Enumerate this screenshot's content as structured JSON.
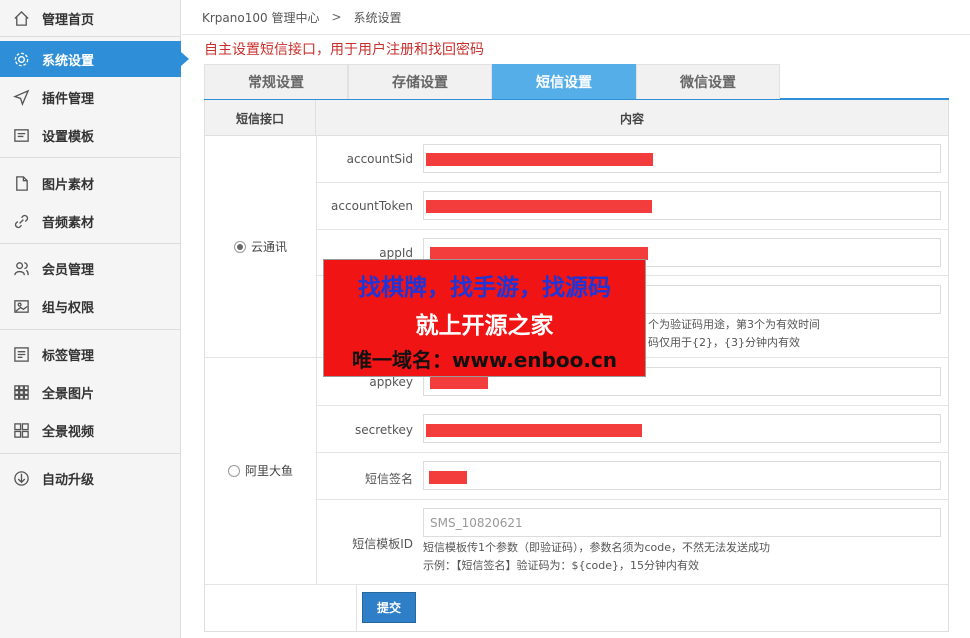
{
  "sidebar": {
    "items": [
      {
        "label": "管理首页",
        "icon": "home-icon"
      },
      {
        "label": "系统设置",
        "icon": "gear-icon",
        "active": true
      },
      {
        "label": "插件管理",
        "icon": "send-icon"
      },
      {
        "label": "设置模板",
        "icon": "template-icon"
      },
      {
        "label": "图片素材",
        "icon": "file-icon"
      },
      {
        "label": "音频素材",
        "icon": "link-icon"
      },
      {
        "label": "会员管理",
        "icon": "users-icon"
      },
      {
        "label": "组与权限",
        "icon": "image-icon"
      },
      {
        "label": "标签管理",
        "icon": "list-icon"
      },
      {
        "label": "全景图片",
        "icon": "grid-icon"
      },
      {
        "label": "全景视频",
        "icon": "apps-icon"
      },
      {
        "label": "自动升级",
        "icon": "download-icon"
      }
    ]
  },
  "breadcrumb": {
    "root": "Krpano100 管理中心",
    "sep": ">",
    "current": "系统设置"
  },
  "intro": "自主设置短信接口，用于用户注册和找回密码",
  "tabs": [
    "常规设置",
    "存储设置",
    "短信设置",
    "微信设置"
  ],
  "table": {
    "col1": "短信接口",
    "col2": "内容",
    "providers": [
      {
        "name": "云通讯",
        "selected": true,
        "fields": [
          {
            "label": "accountSid"
          },
          {
            "label": "accountToken"
          },
          {
            "label": "appId"
          }
        ],
        "hint_lines": [
          "个为验证码用途，第3个为有效时间",
          "码仅用于{2}，{3}分钟内有效"
        ]
      },
      {
        "name": "阿里大鱼",
        "selected": false,
        "fields": [
          {
            "label": "appkey"
          },
          {
            "label": "secretkey"
          },
          {
            "label": "短信签名"
          },
          {
            "label": "短信模板ID",
            "placeholder": "SMS_10820621"
          }
        ],
        "hint_lines": [
          "短信模板传1个参数（即验证码），参数名须为code，不然无法发送成功",
          "示例：【短信签名】验证码为：${code}，15分钟内有效"
        ]
      }
    ],
    "submit": "提交"
  },
  "banner": {
    "line1": "找棋牌，找手游，找源码",
    "line2": "就上开源之家",
    "line3": "唯一域名：www.enboo.cn"
  },
  "colors": {
    "accent": "#2e8fd8",
    "tab_active": "#56aee9",
    "redaction": "#f33c3c",
    "intro_red": "#c9302c"
  }
}
